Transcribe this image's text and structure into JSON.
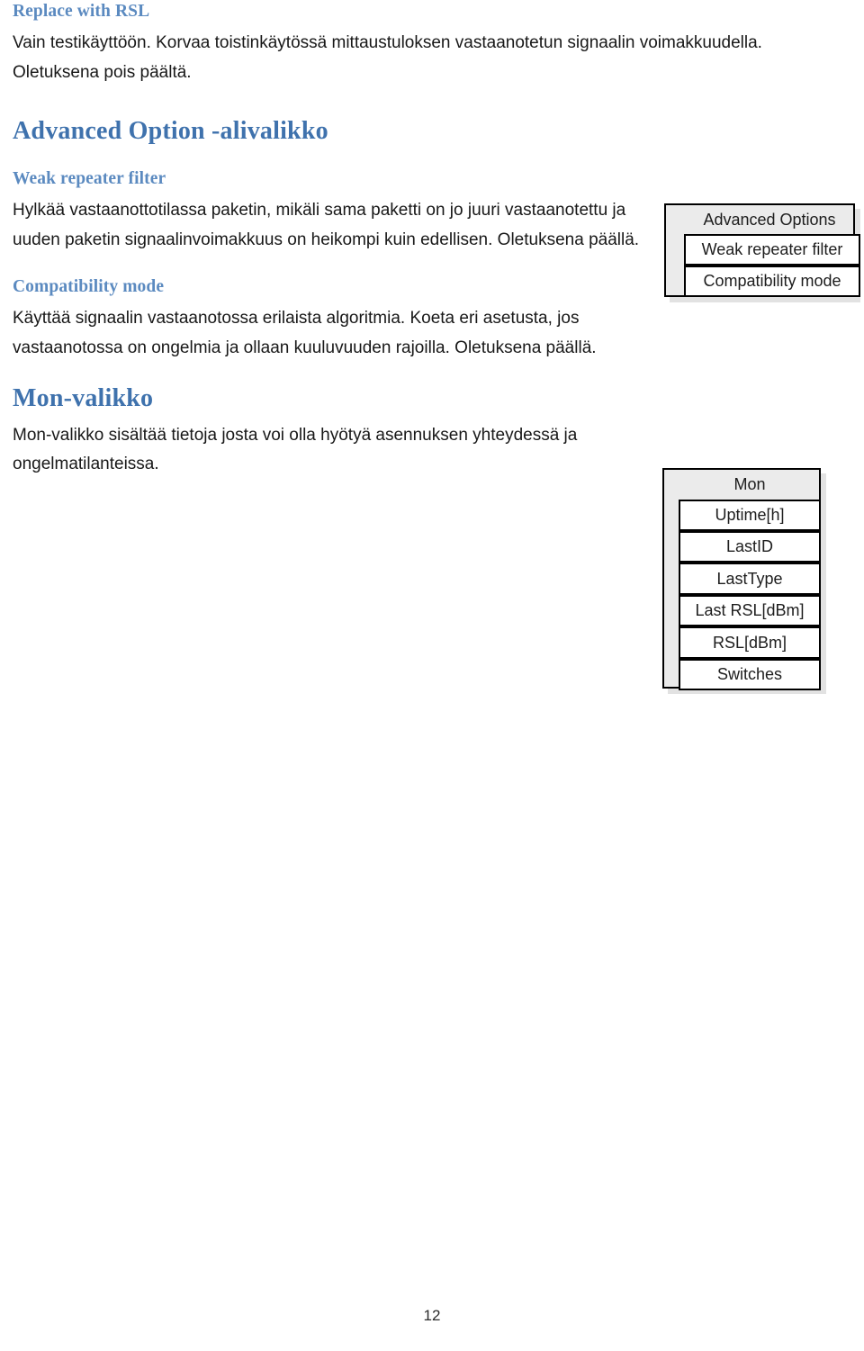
{
  "document": {
    "page_number": "12",
    "colors": {
      "heading_small": "#5b8ac0",
      "heading_large": "#3f72ad",
      "body_text": "#181818",
      "menu_panel_fill": "#ebebeb",
      "menu_item_fill": "#ffffff",
      "menu_border": "#000000",
      "menu_shadow": "#e2e2e2"
    }
  },
  "sections": {
    "replace_with_rsl": {
      "heading": "Replace with RSL",
      "paragraph": "Vain testikäyttöön. Korvaa toistinkäytössä mittaustuloksen vastaanotetun signaalin voimakkuudella. Oletuksena pois päältä."
    },
    "advanced_option": {
      "heading": "Advanced Option -alivalikko",
      "weak_repeater_filter": {
        "heading": "Weak repeater filter",
        "paragraph": "Hylkää vastaanottotilassa paketin, mikäli sama paketti on jo juuri vastaanotettu ja uuden paketin signaalinvoimakkuus on heikompi kuin edellisen. Oletuksena päällä."
      },
      "compatibility_mode": {
        "heading": "Compatibility mode",
        "paragraph": "Käyttää signaalin vastaanotossa erilaista algoritmia. Koeta eri asetusta, jos vastaanotossa on ongelmia ja ollaan kuuluvuuden rajoilla. Oletuksena päällä."
      }
    },
    "mon_valikko": {
      "heading": "Mon-valikko",
      "paragraph": "Mon-valikko sisältää tietoja josta voi olla hyötyä asennuksen yhteydessä ja ongelmatilanteissa."
    }
  },
  "menus": {
    "advanced_options": {
      "title": "Advanced Options",
      "items": [
        {
          "label": "Weak repeater filter"
        },
        {
          "label": "Compatibility mode"
        }
      ]
    },
    "mon": {
      "title": "Mon",
      "items": [
        {
          "label": "Uptime[h]"
        },
        {
          "label": "LastID"
        },
        {
          "label": "LastType"
        },
        {
          "label": "Last RSL[dBm]"
        },
        {
          "label": "RSL[dBm]"
        },
        {
          "label": "Switches"
        }
      ]
    }
  }
}
